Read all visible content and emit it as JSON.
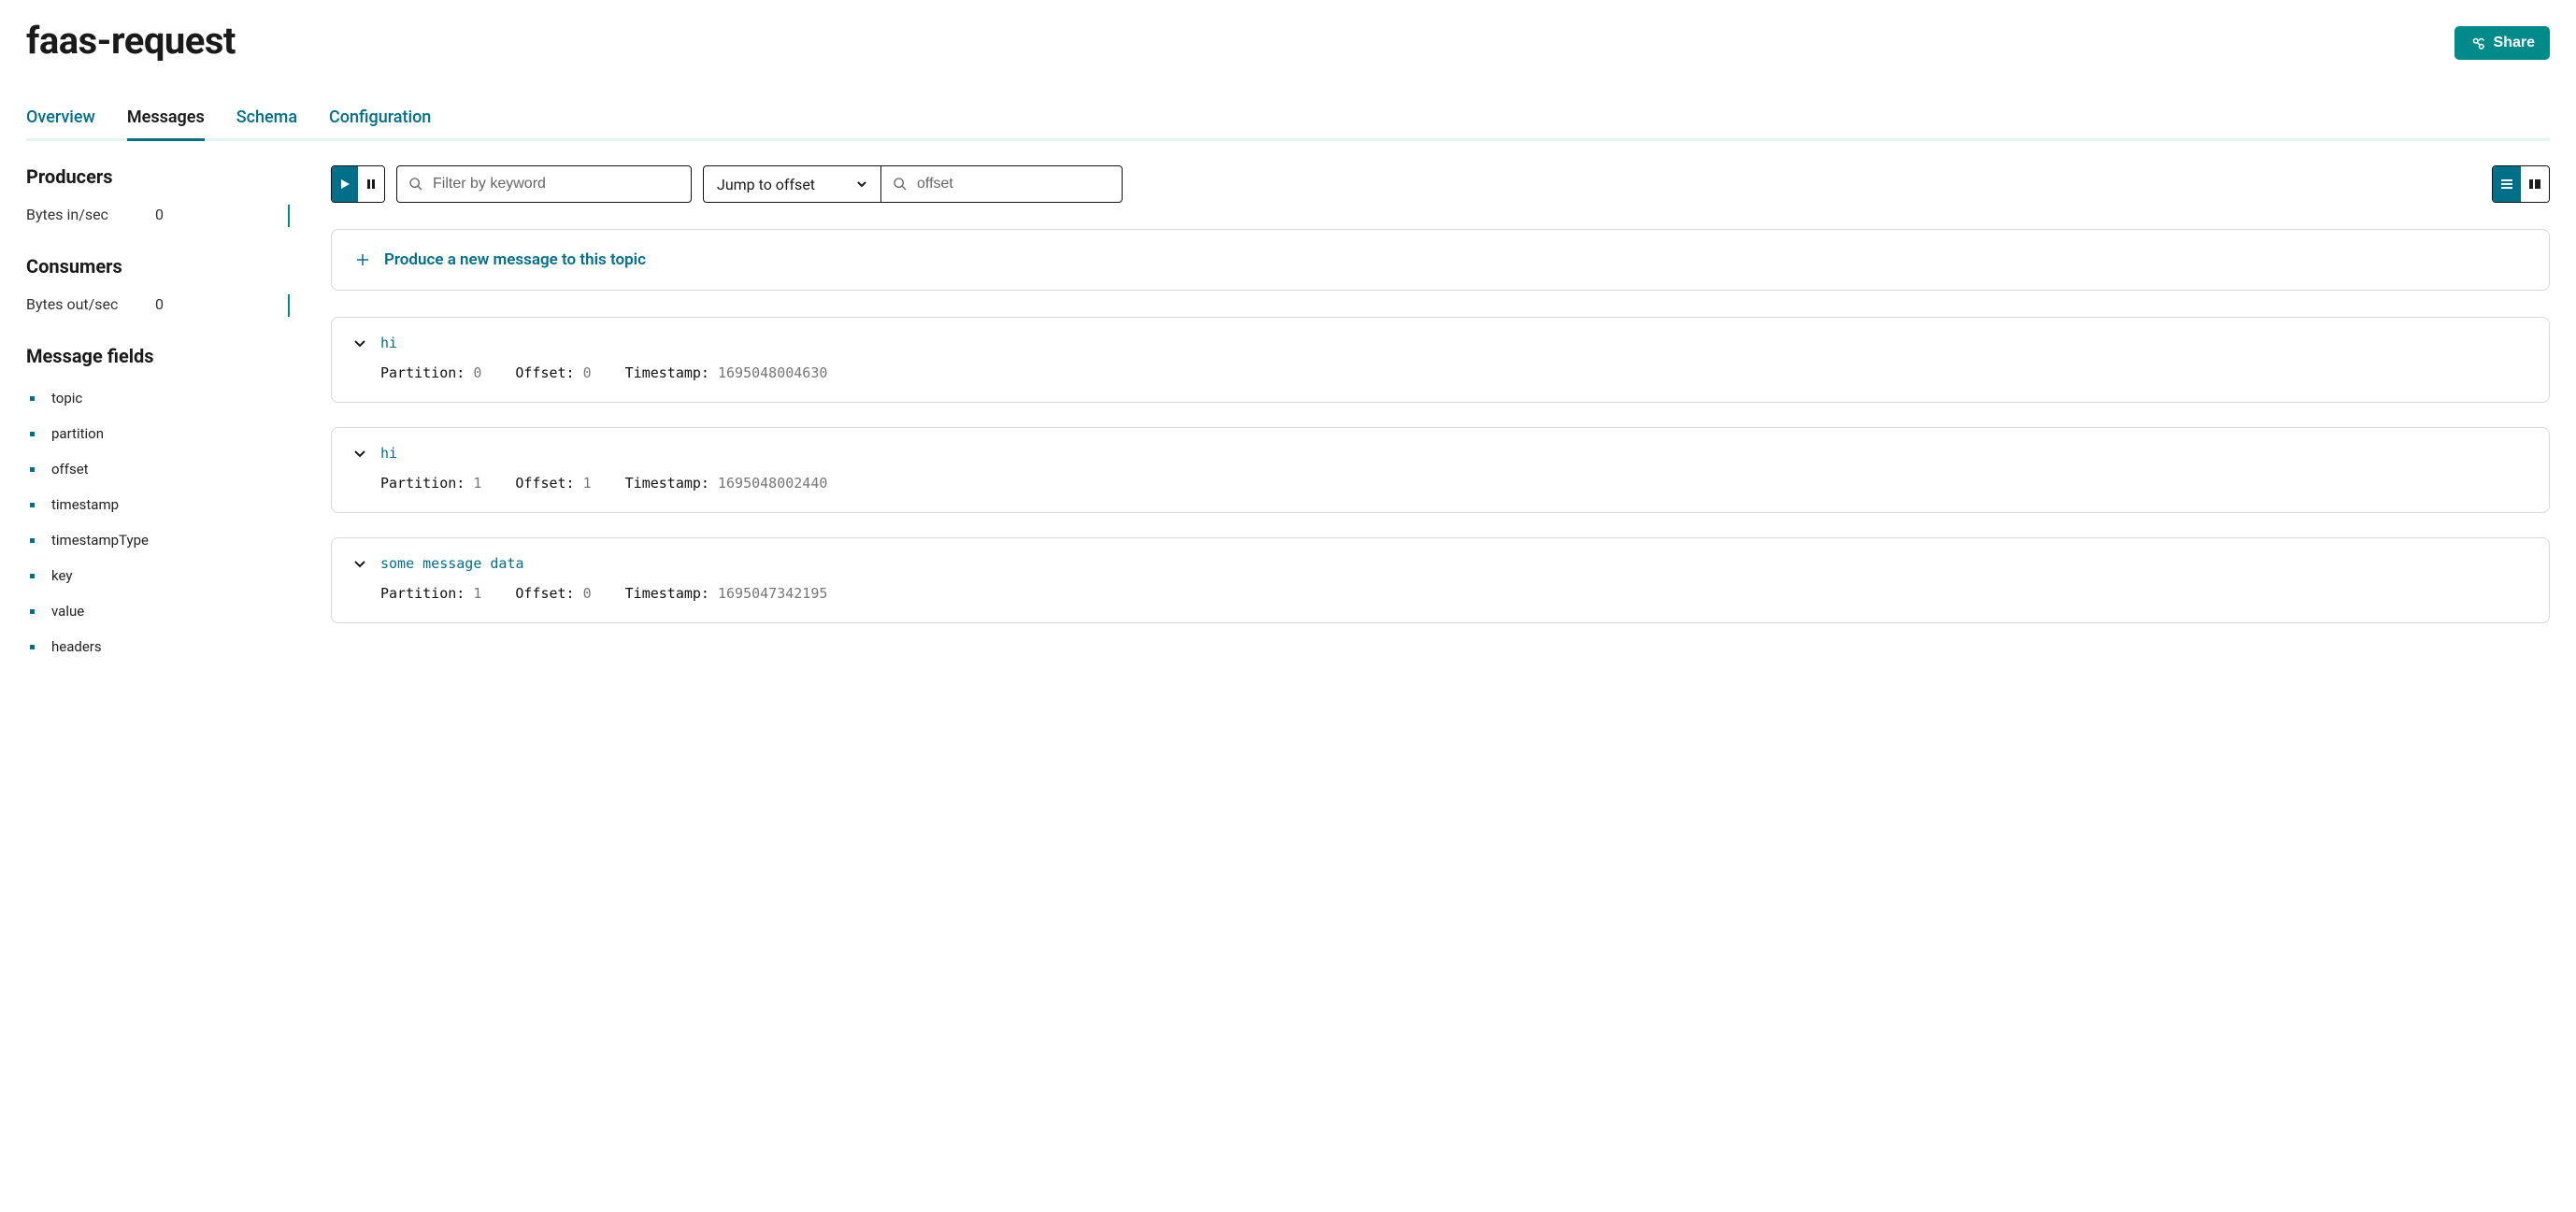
{
  "header": {
    "title": "faas-request",
    "share_label": "Share"
  },
  "tabs": [
    {
      "label": "Overview",
      "active": false
    },
    {
      "label": "Messages",
      "active": true
    },
    {
      "label": "Schema",
      "active": false
    },
    {
      "label": "Configuration",
      "active": false
    }
  ],
  "sidebar": {
    "producers": {
      "heading": "Producers",
      "metric_label": "Bytes in/sec",
      "metric_value": "0"
    },
    "consumers": {
      "heading": "Consumers",
      "metric_label": "Bytes out/sec",
      "metric_value": "0"
    },
    "fields": {
      "heading": "Message fields",
      "items": [
        "topic",
        "partition",
        "offset",
        "timestamp",
        "timestampType",
        "key",
        "value",
        "headers"
      ]
    }
  },
  "toolbar": {
    "filter_placeholder": "Filter by keyword",
    "jump_label": "Jump to offset",
    "offset_placeholder": "offset"
  },
  "produce": {
    "label": "Produce a new message to this topic"
  },
  "meta_labels": {
    "partition": "Partition:",
    "offset": "Offset:",
    "timestamp": "Timestamp:"
  },
  "messages": [
    {
      "title": "hi",
      "partition": "0",
      "offset": "0",
      "timestamp": "1695048004630"
    },
    {
      "title": "hi",
      "partition": "1",
      "offset": "1",
      "timestamp": "1695048002440"
    },
    {
      "title": "some message data",
      "partition": "1",
      "offset": "0",
      "timestamp": "1695047342195"
    }
  ]
}
